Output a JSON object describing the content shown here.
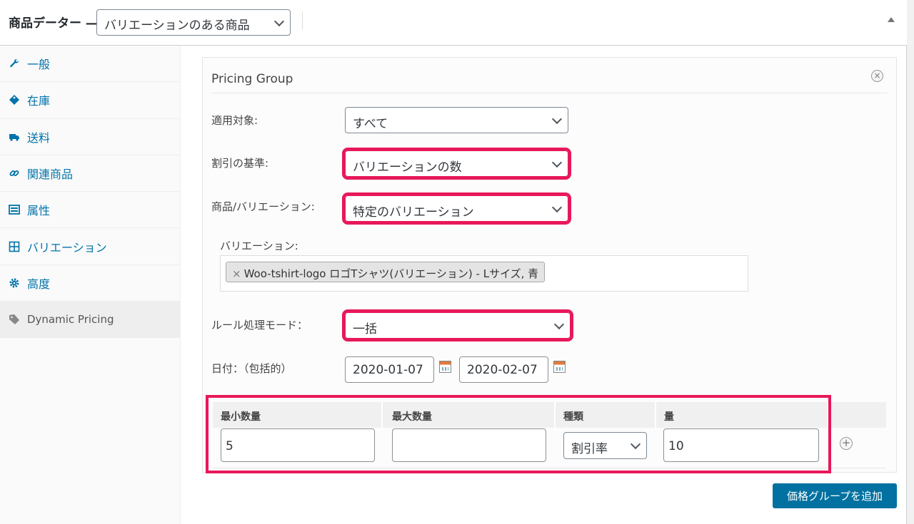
{
  "header": {
    "title": "商品データー —",
    "product_type": "バリエーションのある商品"
  },
  "sidebar": {
    "items": [
      {
        "label": "一般",
        "icon": "wrench-icon"
      },
      {
        "label": "在庫",
        "icon": "tag-icon"
      },
      {
        "label": "送料",
        "icon": "truck-icon"
      },
      {
        "label": "関連商品",
        "icon": "link-icon"
      },
      {
        "label": "属性",
        "icon": "list-icon"
      },
      {
        "label": "バリエーション",
        "icon": "grid-icon"
      },
      {
        "label": "高度",
        "icon": "gear-icon"
      },
      {
        "label": "Dynamic Pricing",
        "icon": "price-tag-icon"
      }
    ]
  },
  "pricing_group": {
    "title": "Pricing Group",
    "applies_to_label": "適用対象:",
    "applies_to_value": "すべて",
    "discount_basis_label": "割引の基準:",
    "discount_basis_value": "バリエーションの数",
    "product_variation_label": "商品/バリエーション:",
    "product_variation_value": "特定のバリエーション",
    "variation_label": "バリエーション:",
    "variation_chip": "Woo-tshirt-logo ロゴTシャツ(バリエーション) - Lサイズ, 青",
    "chip_remove": "×",
    "rule_mode_label": "ルール処理モード：",
    "rule_mode_value": "一括",
    "date_label": "日付：（包括的）",
    "date_from": "2020-01-07",
    "date_to": "2020-02-07"
  },
  "rules_table": {
    "headers": [
      "最小数量",
      "最大数量",
      "種類",
      "量"
    ],
    "row": {
      "min": "5",
      "max": "",
      "type": "割引率",
      "amount": "10"
    }
  },
  "add_group_button": "価格グループを追加",
  "colors": {
    "highlight": "#e8185a",
    "link": "#0073aa",
    "primary_button": "#0071a1"
  }
}
